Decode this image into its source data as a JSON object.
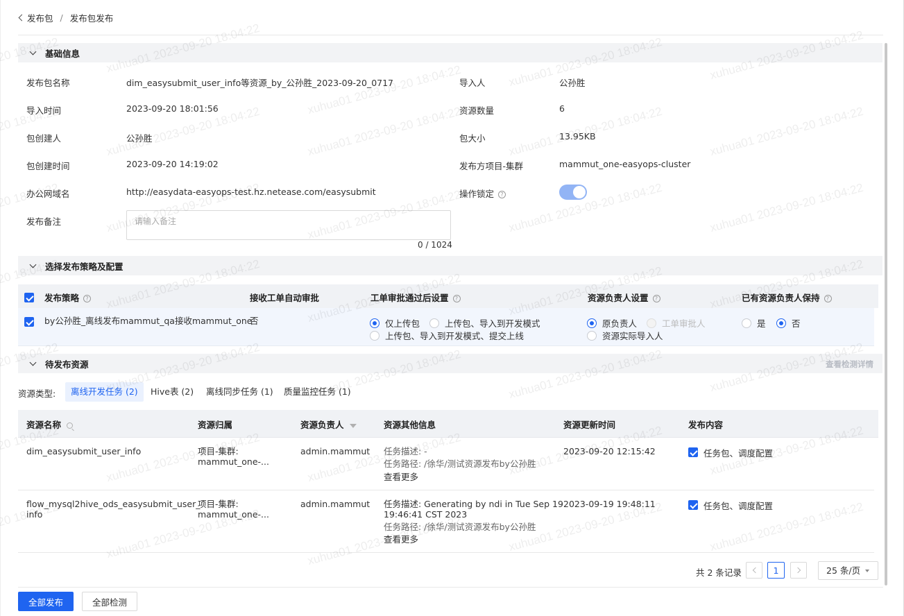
{
  "breadcrumb": {
    "parent": "发布包",
    "separator": "/",
    "current": "发布包发布"
  },
  "basic_info": {
    "title": "基础信息",
    "package_name_label": "发布包名称",
    "package_name": "dim_easysubmit_user_info等资源_by_公孙胜_2023-09-20_0717",
    "importer_label": "导入人",
    "importer": "公孙胜",
    "import_time_label": "导入时间",
    "import_time": "2023-09-20 18:01:56",
    "resource_count_label": "资源数量",
    "resource_count": "6",
    "creator_label": "包创建人",
    "creator": "公孙胜",
    "size_label": "包大小",
    "size": "13.95KB",
    "create_time_label": "包创建时间",
    "create_time": "2023-09-20 14:19:02",
    "project_cluster_label": "发布方项目-集群",
    "project_cluster": "mammut_one-easyops-cluster",
    "domain_label": "办公网域名",
    "domain": "http://easydata-easyops-test.hz.netease.com/easysubmit",
    "lock_label": "操作锁定",
    "lock_on": true,
    "remark_label": "发布备注",
    "remark_placeholder": "请输入备注",
    "remark_count": "0 / 1024"
  },
  "strategy": {
    "title": "选择发布策略及配置",
    "columns": [
      "发布策略",
      "接收工单自动审批",
      "工单审批通过后设置",
      "资源负责人设置",
      "已有资源负责人保持"
    ],
    "row": {
      "name": "by公孙胜_离线发布mammut_qa接收mammut_one",
      "auto_approve": "否",
      "after_approve_options": [
        "仅上传包",
        "上传包、导入到开发模式",
        "上传包、导入到开发模式、提交上线"
      ],
      "after_approve_selected": 0,
      "owner_options": [
        "原负责人",
        "工单审批人",
        "资源实际导入人"
      ],
      "owner_selected": 0,
      "keep_options": [
        "是",
        "否"
      ],
      "keep_selected": 1
    }
  },
  "pending": {
    "title": "待发布资源",
    "detail_link": "查看检测详情",
    "type_label": "资源类型:",
    "tabs": [
      "离线开发任务 (2)",
      "Hive表 (2)",
      "离线同步任务 (1)",
      "质量监控任务 (1)"
    ],
    "active_tab": 0,
    "columns": [
      "资源名称",
      "资源归属",
      "资源负责人",
      "资源其他信息",
      "资源更新时间",
      "发布内容"
    ],
    "rows": [
      {
        "name": "dim_easysubmit_user_info",
        "name2": "",
        "owner_line1": "项目-集群:",
        "owner_line2": "mammut_one-...",
        "person": "admin.mammut",
        "desc": "任务描述: -",
        "desc2": "",
        "path": "任务路径: /徐华/测试资源发布by公孙胜",
        "more": "查看更多",
        "updated": "2023-09-20 12:15:42",
        "content": "任务包、调度配置"
      },
      {
        "name": "flow_mysql2hive_ods_easysubmit_user_",
        "name2": "info",
        "owner_line1": "项目-集群:",
        "owner_line2": "mammut_one-...",
        "person": "admin.mammut",
        "desc": "任务描述: Generating by ndi in Tue Sep 19",
        "desc2": "19:46:41 CST 2023",
        "path": "任务路径: /徐华/测试资源发布by公孙胜",
        "more": "查看更多",
        "updated": "2023-09-19 19:48:11",
        "content": "任务包、调度配置"
      }
    ]
  },
  "pagination": {
    "total": "共 2 条记录",
    "page": "1",
    "page_size": "25 条/页"
  },
  "actions": {
    "publish_all": "全部发布",
    "check_all": "全部检测"
  },
  "watermark": "xuhua01 2023-09-20 18:04:22",
  "colors": {
    "primary": "#1f64f0",
    "header_bg": "#f2f3f5",
    "toggle_on": "#92b4f5"
  }
}
